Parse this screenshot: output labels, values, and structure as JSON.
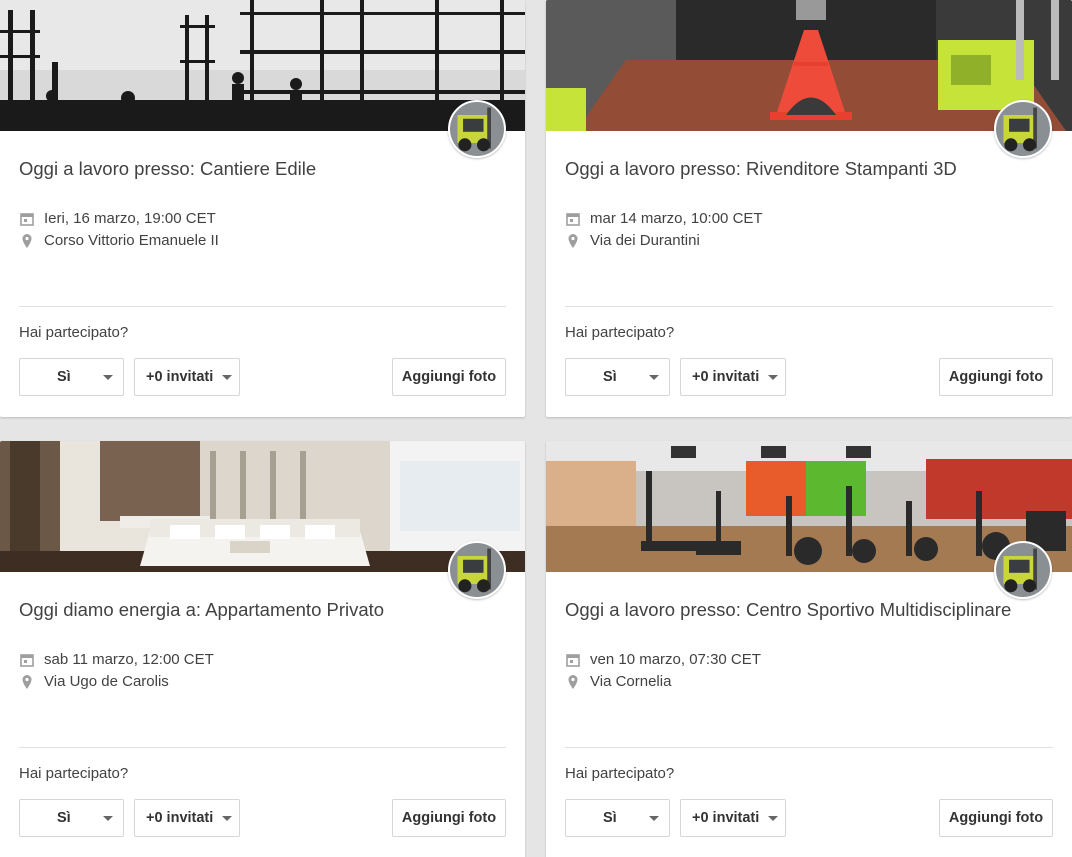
{
  "cards": [
    {
      "title": "Oggi a lavoro presso: Cantiere Edile",
      "date": "Ieri, 16 marzo, 19:00 CET",
      "location": "Corso Vittorio Emanuele II",
      "question": "Hai partecipato?",
      "rsvp": "Sì",
      "guests": "+0 invitati",
      "add_photo": "Aggiungi foto"
    },
    {
      "title": "Oggi a lavoro presso: Rivenditore Stampanti 3D",
      "date": "mar 14 marzo, 10:00 CET",
      "location": "Via dei Durantini",
      "question": "Hai partecipato?",
      "rsvp": "Sì",
      "guests": "+0 invitati",
      "add_photo": "Aggiungi foto"
    },
    {
      "title": "Oggi diamo energia a: Appartamento Privato",
      "date": "sab 11 marzo, 12:00 CET",
      "location": "Via Ugo de Carolis",
      "question": "Hai partecipato?",
      "rsvp": "Sì",
      "guests": "+0 invitati",
      "add_photo": "Aggiungi foto"
    },
    {
      "title": "Oggi a lavoro presso: Centro Sportivo Multidisciplinare",
      "date": "ven 10 marzo, 07:30 CET",
      "location": "Via Cornelia",
      "question": "Hai partecipato?",
      "rsvp": "Sì",
      "guests": "+0 invitati",
      "add_photo": "Aggiungi foto"
    }
  ],
  "icons": {
    "date": "calendar-icon",
    "location": "map-pin-icon",
    "dropdown": "caret-down-icon",
    "avatar": "forklift-avatar"
  },
  "colors": {
    "background": "#e5e5e5",
    "card": "#ffffff",
    "text": "#424242",
    "icon": "#9e9e9e"
  }
}
